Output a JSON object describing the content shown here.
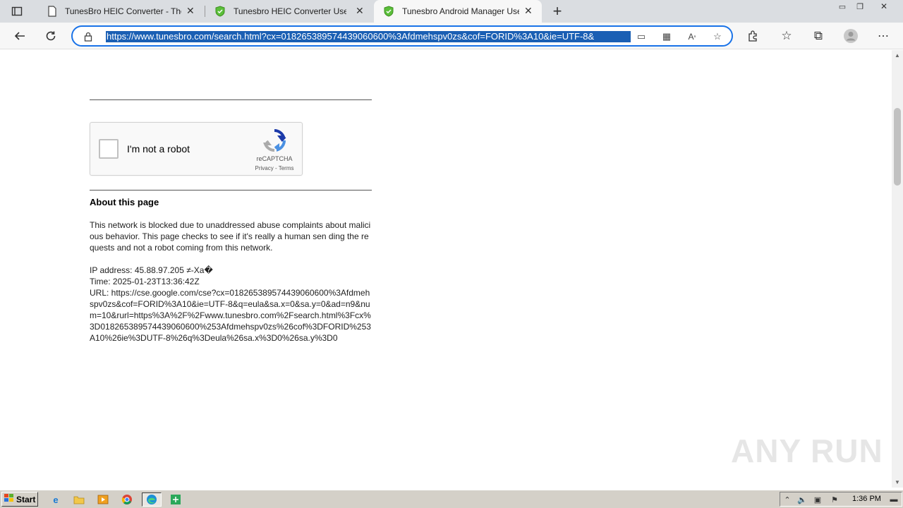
{
  "tabs": [
    {
      "title": "TunesBro HEIC Converter - The",
      "icon": "page-icon"
    },
    {
      "title": "Tunesbro HEIC Converter User G",
      "icon": "shield-icon"
    },
    {
      "title": "Tunesbro Android Manager Use",
      "icon": "shield-icon"
    }
  ],
  "toolbar": {
    "url": "https://www.tunesbro.com/search.html?cx=018265389574439060600%3Afdmehspv0zs&cof=FORID%3A10&ie=UTF-8&"
  },
  "captcha": {
    "label": "I'm not a robot",
    "brand": "reCAPTCHA",
    "links": "Privacy - Terms"
  },
  "about": {
    "title": "About this page",
    "body": "This network is blocked due to unaddressed abuse complaints about malicious behavior. This page checks to see if it's really a human sen ding the requests and not a robot coming from this network.",
    "ip_line": "IP address: 45.88.97.205 ≠-Xa�",
    "time_line": "Time: 2025-01-23T13:36:42Z",
    "url_line": "URL: https://cse.google.com/cse?cx=018265389574439060600%3Afdmehspv0zs&cof=FORID%3A10&ie=UTF-8&q=eula&sa.x=0&sa.y=0&ad=n9&num=10&rurl=https%3A%2F%2Fwww.tunesbro.com%2Fsearch.html%3Fcx%3D018265389574439060600%253Afdmehspv0zs%26cof%3DFORID%253A10%26ie%3DUTF-8%26q%3Deula%26sa.x%3D0%26sa.y%3D0"
  },
  "watermark": "ANY RUN",
  "taskbar": {
    "start_label": "Start",
    "clock": "1:36 PM"
  }
}
